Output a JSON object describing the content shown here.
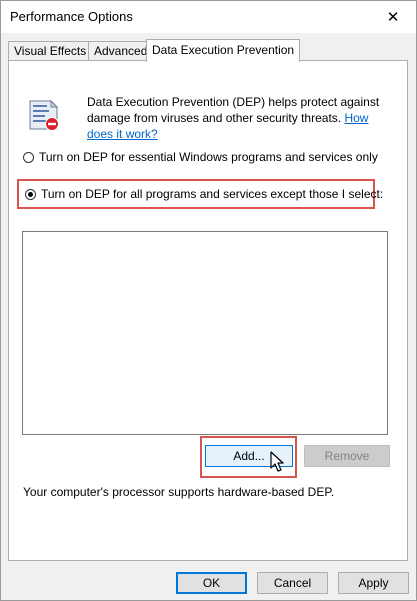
{
  "window": {
    "title": "Performance Options",
    "close_glyph": "✕"
  },
  "tabs": [
    {
      "label": "Visual Effects"
    },
    {
      "label": "Advanced"
    },
    {
      "label": "Data Execution Prevention",
      "active": true
    }
  ],
  "dep": {
    "description": "Data Execution Prevention (DEP) helps protect against damage from viruses and other security threats.",
    "link_text": "How does it work?",
    "option_essential": "Turn on DEP for essential Windows programs and services only",
    "option_all": "Turn on DEP for all programs and services except those I select:",
    "selected_option": "all",
    "add_button": "Add...",
    "remove_button": "Remove",
    "processor_note": "Your computer's processor supports hardware-based DEP."
  },
  "footer": {
    "ok": "OK",
    "cancel": "Cancel",
    "apply": "Apply"
  },
  "colors": {
    "highlight": "#d9534f",
    "link": "#0066cc",
    "accent": "#0078d7"
  }
}
